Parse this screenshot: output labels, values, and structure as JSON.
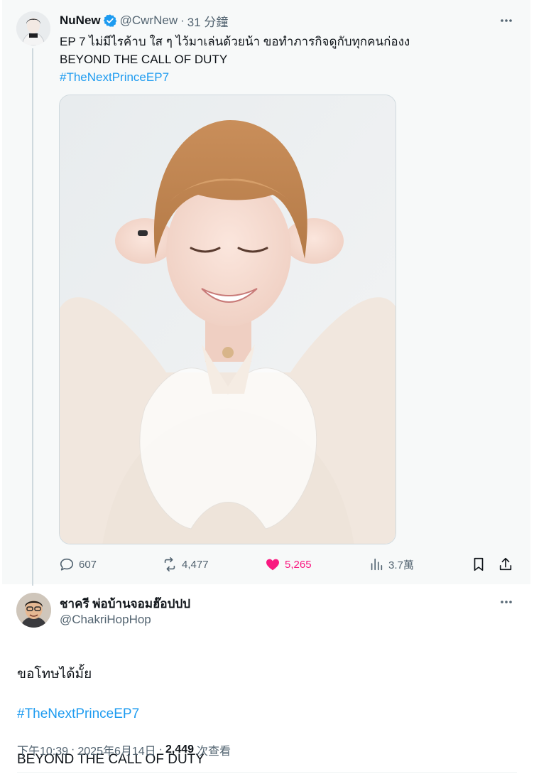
{
  "tweet": {
    "author": {
      "display_name": "NuNew",
      "handle": "@CwrNew",
      "verified": true,
      "avatar_icon": "user-avatar-photo"
    },
    "time": "31 分鐘",
    "separator": "·",
    "text_line1": "EP 7 ไม่มีไรค้าบ ใส ๆ ไว้มาเล่นด้วยน้า ขอทำภารกิจดูกับทุกคนก่องง",
    "text_line2": "BEYOND THE CALL OF DUTY",
    "hashtag": "#TheNextPrinceEP7",
    "media_icon": "photo-portrait",
    "actions": {
      "replies": "607",
      "retweets": "4,477",
      "likes": "5,265",
      "views": "3.7萬"
    }
  },
  "reply": {
    "author": {
      "display_name": "ชาครี พ่อบ้านจอมฮ๊อปปป",
      "handle": "@ChakriHopHop",
      "avatar_icon": "user-avatar-photo"
    },
    "text_line1": "ขอโทษได้มั้ย",
    "text_line2": "BEYOND THE CALL OF DUTY",
    "hashtag": "#TheNextPrinceEP7",
    "meta": {
      "time": "下午10:39",
      "date": "2025年6月14日",
      "separator": "·",
      "views_count": "2,449",
      "views_label": "次查看"
    }
  },
  "colors": {
    "accent": "#1d9bf0",
    "like": "#f91880",
    "muted": "#536471",
    "text": "#0f1419",
    "thread_bg": "#f7f9f9"
  }
}
